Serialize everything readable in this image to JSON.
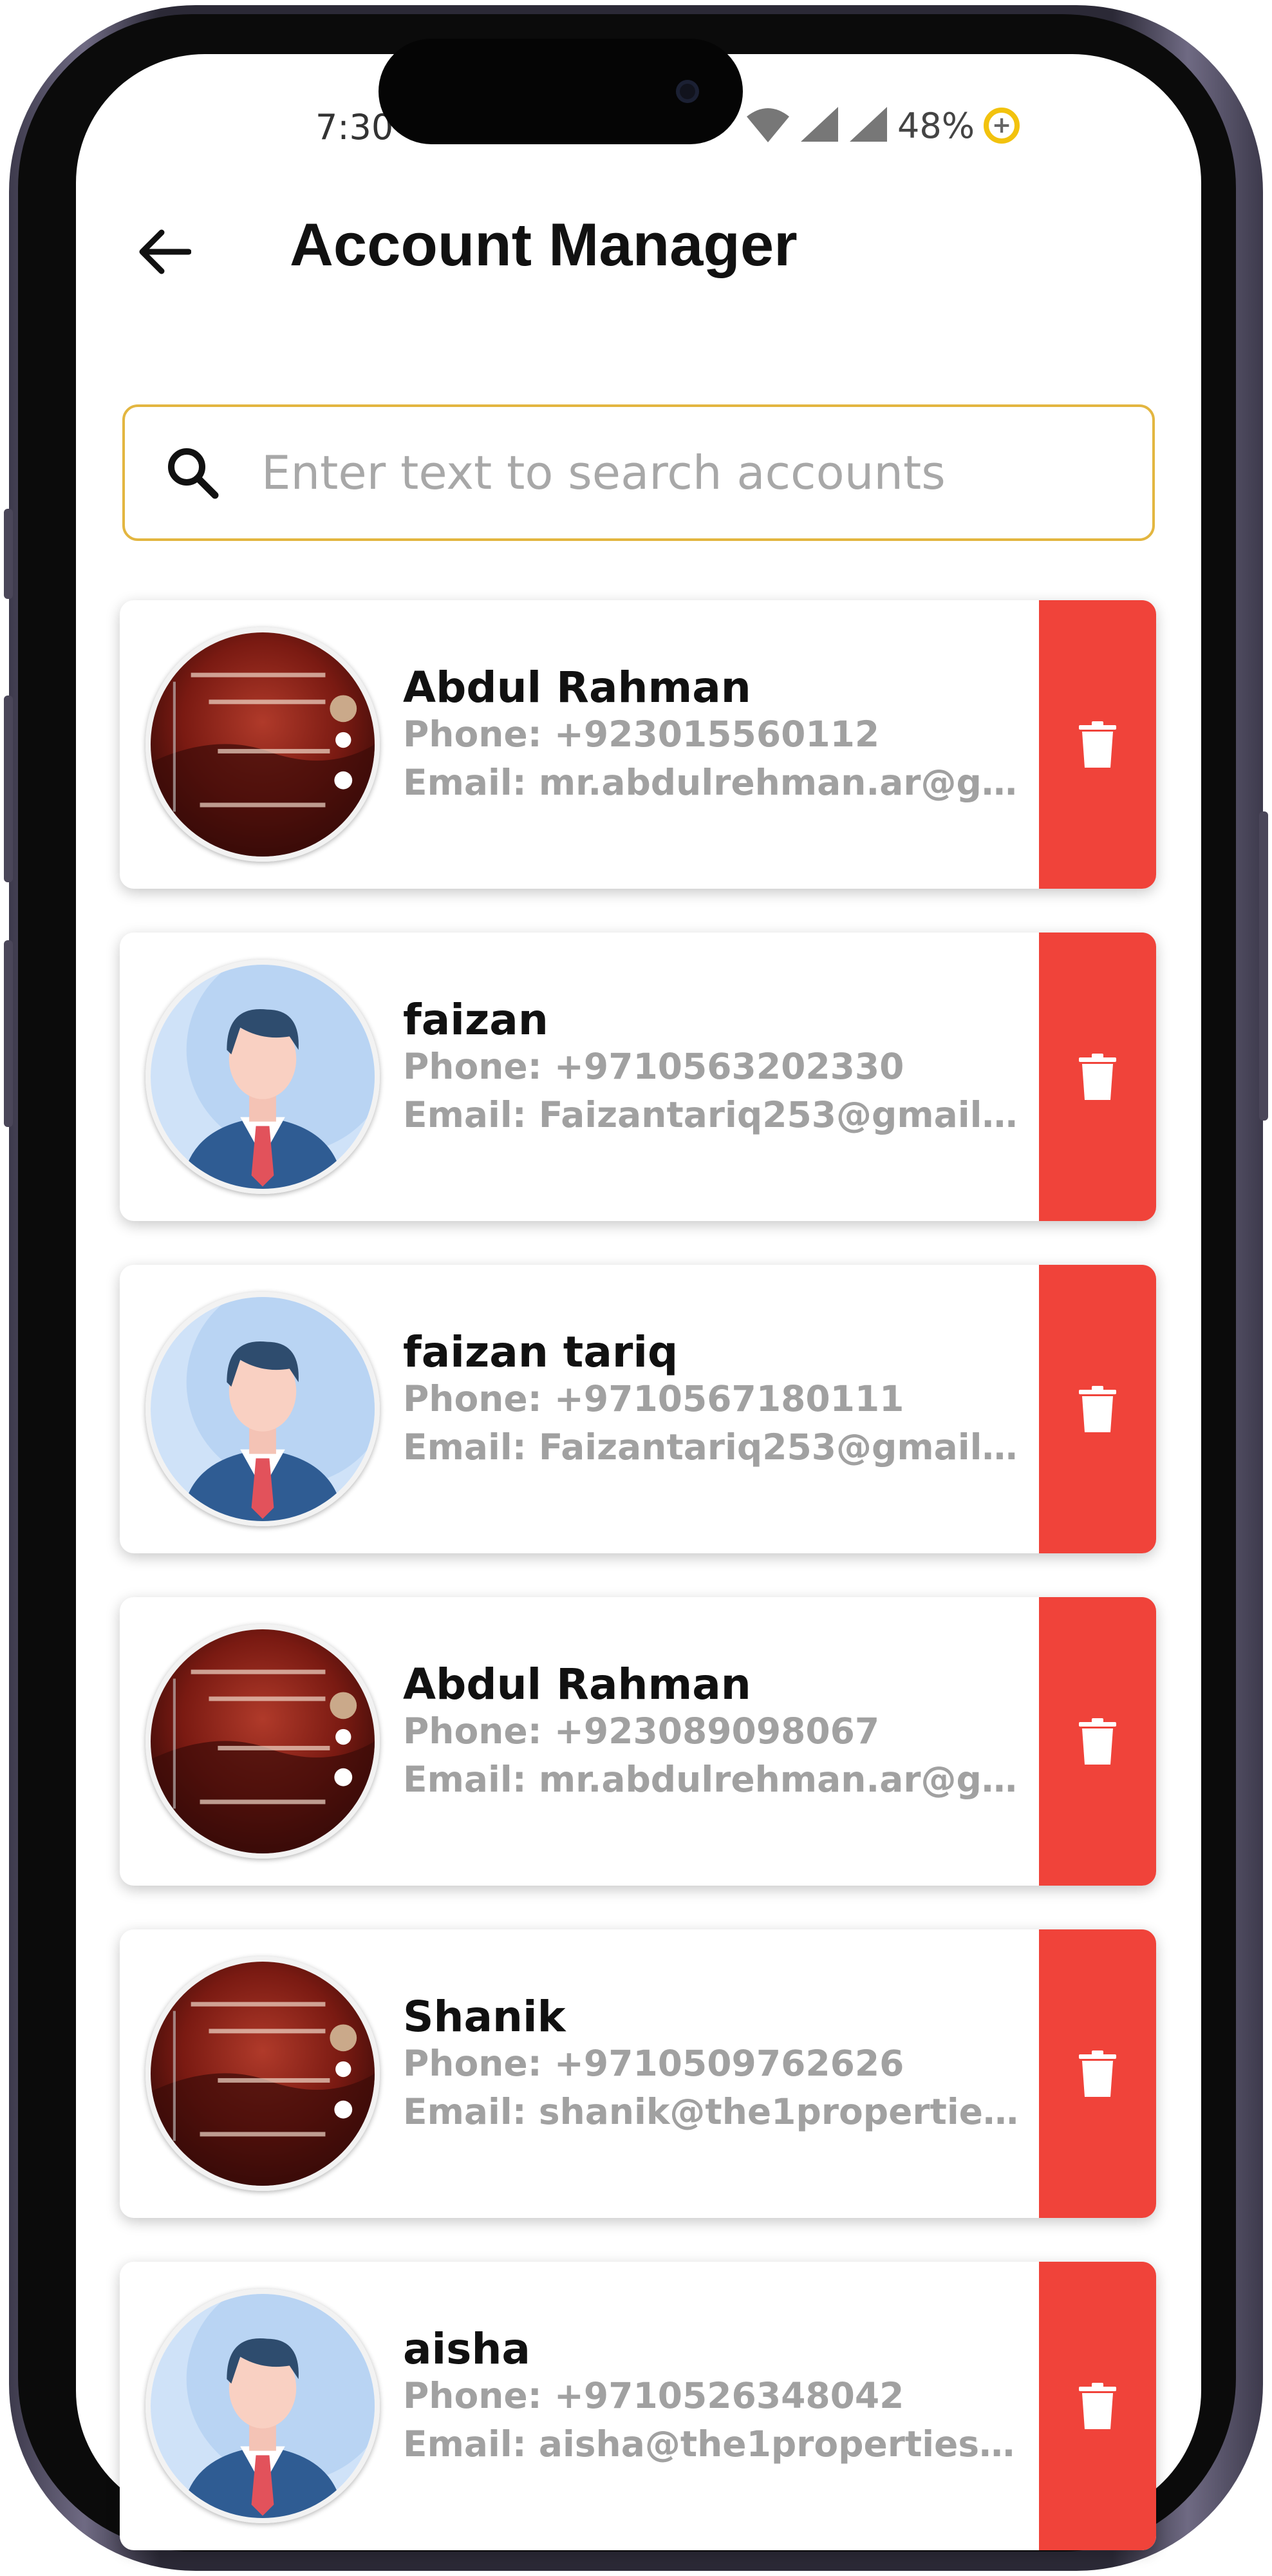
{
  "status_bar": {
    "time": "7:30",
    "battery": "48%",
    "battery_badge": "+"
  },
  "header": {
    "title": "Account Manager",
    "back_icon": "arrow-left-icon"
  },
  "search": {
    "placeholder": "Enter text to search accounts",
    "value": "",
    "icon": "search-icon",
    "border_color": "#e3b640"
  },
  "colors": {
    "delete_button": "#f0433a",
    "secondary_text": "#a1a1a1"
  },
  "accounts": [
    {
      "name": "Abdul Rahman",
      "phone": "Phone: +923015560112",
      "email": "Email: mr.abdulrehman.ar@g...",
      "avatar": "photo-avatar"
    },
    {
      "name": "faizan",
      "phone": "Phone: +9710563202330",
      "email": "Email: Faizantariq253@gmail.c...",
      "avatar": "default-avatar"
    },
    {
      "name": "faizan tariq",
      "phone": "Phone: +9710567180111",
      "email": "Email: Faizantariq253@gmail.c...",
      "avatar": "default-avatar"
    },
    {
      "name": "Abdul Rahman",
      "phone": "Phone: +923089098067",
      "email": "Email: mr.abdulrehman.ar@g...",
      "avatar": "photo-avatar"
    },
    {
      "name": "Shanik",
      "phone": "Phone: +9710509762626",
      "email": "Email: shanik@the1properties....",
      "avatar": "photo-avatar"
    },
    {
      "name": "aisha",
      "phone": "Phone: +9710526348042",
      "email": "Email: aisha@the1properties.c...",
      "avatar": "default-avatar"
    }
  ]
}
